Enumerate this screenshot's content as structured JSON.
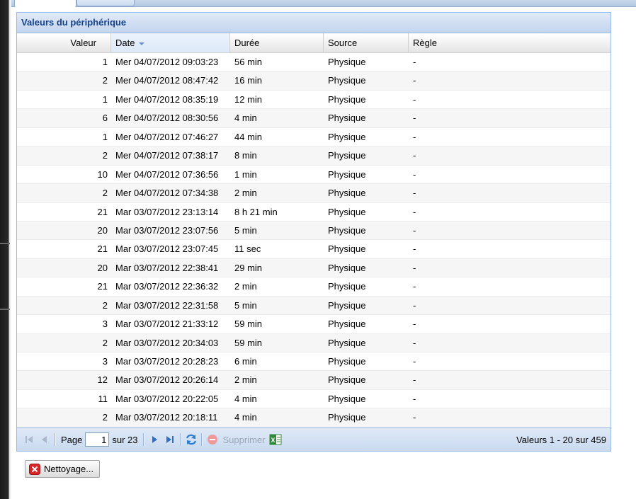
{
  "panel": {
    "title": "Valeurs du périphérique"
  },
  "columns": [
    "Valeur",
    "Date",
    "Durée",
    "Source",
    "Règle"
  ],
  "rows": [
    [
      "1",
      "Mer 04/07/2012 09:03:23",
      "56 min",
      "Physique",
      "-"
    ],
    [
      "2",
      "Mer 04/07/2012 08:47:42",
      "16 min",
      "Physique",
      "-"
    ],
    [
      "1",
      "Mer 04/07/2012 08:35:19",
      "12 min",
      "Physique",
      "-"
    ],
    [
      "6",
      "Mer 04/07/2012 08:30:56",
      "4 min",
      "Physique",
      "-"
    ],
    [
      "1",
      "Mer 04/07/2012 07:46:27",
      "44 min",
      "Physique",
      "-"
    ],
    [
      "2",
      "Mer 04/07/2012 07:38:17",
      "8 min",
      "Physique",
      "-"
    ],
    [
      "10",
      "Mer 04/07/2012 07:36:56",
      "1 min",
      "Physique",
      "-"
    ],
    [
      "2",
      "Mer 04/07/2012 07:34:38",
      "2 min",
      "Physique",
      "-"
    ],
    [
      "21",
      "Mar 03/07/2012 23:13:14",
      "8 h 21 min",
      "Physique",
      "-"
    ],
    [
      "20",
      "Mar 03/07/2012 23:07:56",
      "5 min",
      "Physique",
      "-"
    ],
    [
      "21",
      "Mar 03/07/2012 23:07:45",
      "11 sec",
      "Physique",
      "-"
    ],
    [
      "20",
      "Mar 03/07/2012 22:38:41",
      "29 min",
      "Physique",
      "-"
    ],
    [
      "21",
      "Mar 03/07/2012 22:36:32",
      "2 min",
      "Physique",
      "-"
    ],
    [
      "2",
      "Mar 03/07/2012 22:31:58",
      "5 min",
      "Physique",
      "-"
    ],
    [
      "3",
      "Mar 03/07/2012 21:33:12",
      "59 min",
      "Physique",
      "-"
    ],
    [
      "2",
      "Mar 03/07/2012 20:34:03",
      "59 min",
      "Physique",
      "-"
    ],
    [
      "3",
      "Mar 03/07/2012 20:28:23",
      "6 min",
      "Physique",
      "-"
    ],
    [
      "12",
      "Mar 03/07/2012 20:26:14",
      "2 min",
      "Physique",
      "-"
    ],
    [
      "11",
      "Mar 03/07/2012 20:22:05",
      "4 min",
      "Physique",
      "-"
    ],
    [
      "2",
      "Mar 03/07/2012 20:18:11",
      "4 min",
      "Physique",
      "-"
    ]
  ],
  "pager": {
    "page_label": "Page",
    "page_value": "1",
    "of_label": "sur 23",
    "delete_label": "Supprimer",
    "summary": "Valeurs 1 - 20 sur 459"
  },
  "clean_button": {
    "label": "Nettoyage..."
  },
  "icons": {
    "first": "first-page-icon",
    "prev": "prev-page-icon",
    "next": "next-page-icon",
    "last": "last-page-icon",
    "refresh": "refresh-icon",
    "delete": "delete-icon",
    "excel": "excel-export-icon",
    "clean": "clear-icon"
  },
  "colors": {
    "header_text": "#15428b",
    "border": "#99bbe8",
    "clean_icon": "#d9262a"
  }
}
